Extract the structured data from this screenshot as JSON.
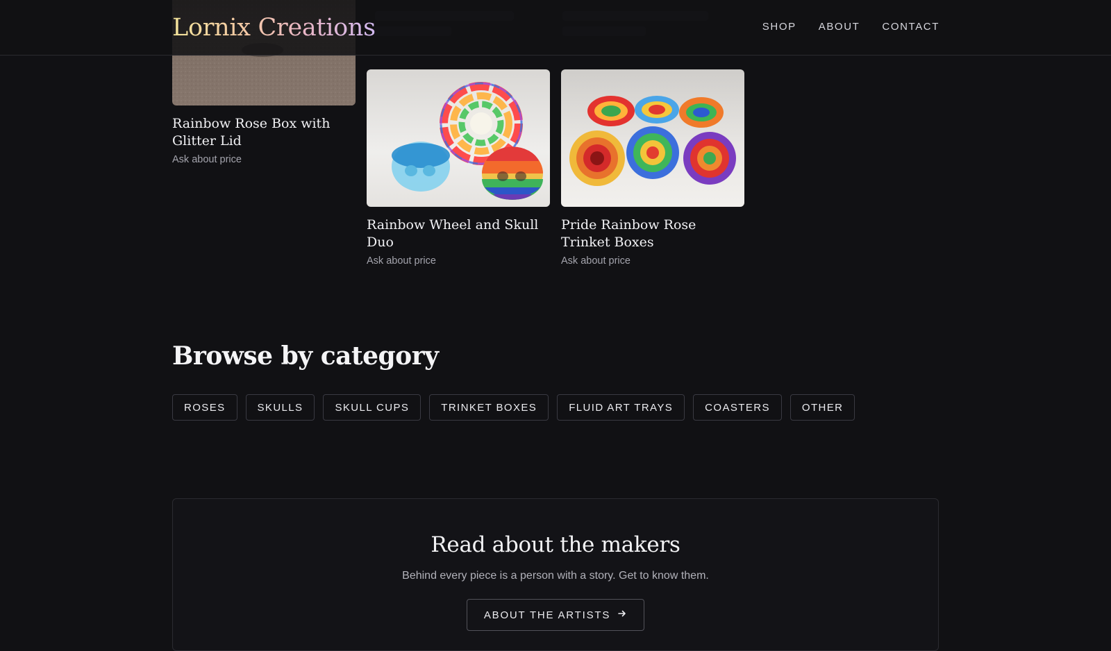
{
  "header": {
    "logo": "Lornix Creations",
    "nav": [
      "SHOP",
      "ABOUT",
      "CONTACT"
    ]
  },
  "products": [
    {
      "title": "Rainbow Rose Box with Glitter Lid",
      "price": "Ask about price"
    },
    {
      "title": "Rainbow Wheel and Skull Duo",
      "price": "Ask about price"
    },
    {
      "title": "Pride Rainbow Rose Trinket Boxes",
      "price": "Ask about price"
    }
  ],
  "categories": {
    "title": "Browse by category",
    "items": [
      "ROSES",
      "SKULLS",
      "SKULL CUPS",
      "TRINKET BOXES",
      "FLUID ART TRAYS",
      "COASTERS",
      "OTHER"
    ]
  },
  "makers": {
    "title": "Read about the makers",
    "text": "Behind every piece is a person with a story. Get to know them.",
    "button": "ABOUT THE ARTISTS",
    "button_icon": "arrow-right-icon"
  },
  "colors": {
    "background": "#111114",
    "logo_gradient": [
      "#f3e49a",
      "#f4c9a4",
      "#e9b6c6",
      "#d2b9f0"
    ]
  }
}
